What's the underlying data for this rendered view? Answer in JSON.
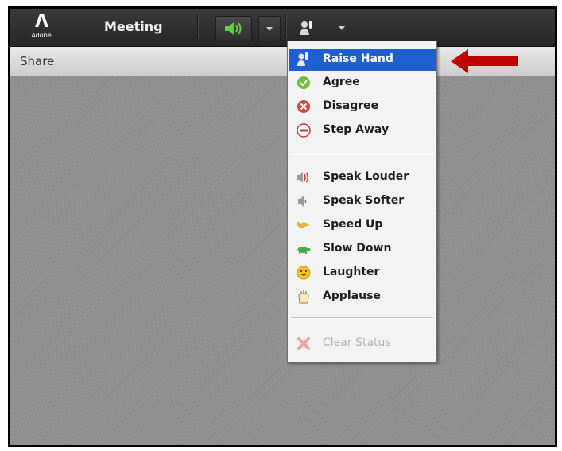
{
  "app": {
    "logo_text": "Adobe",
    "menu_title": "Meeting"
  },
  "toolbar": {
    "audio_icon": "speaker-icon",
    "status_icon": "raise-hand-icon"
  },
  "pod": {
    "title": "Share"
  },
  "status_menu": {
    "items_group1": [
      {
        "label": "Raise Hand",
        "icon": "raise-hand-icon",
        "selected": true
      },
      {
        "label": "Agree",
        "icon": "agree-icon"
      },
      {
        "label": "Disagree",
        "icon": "disagree-icon"
      },
      {
        "label": "Step Away",
        "icon": "step-away-icon"
      }
    ],
    "items_group2": [
      {
        "label": "Speak Louder",
        "icon": "speak-louder-icon"
      },
      {
        "label": "Speak Softer",
        "icon": "speak-softer-icon"
      },
      {
        "label": "Speed Up",
        "icon": "speed-up-icon"
      },
      {
        "label": "Slow Down",
        "icon": "slow-down-icon"
      },
      {
        "label": "Laughter",
        "icon": "laughter-icon"
      },
      {
        "label": "Applause",
        "icon": "applause-icon"
      }
    ],
    "items_group3": [
      {
        "label": "Clear Status",
        "icon": "clear-status-icon",
        "disabled": true
      }
    ]
  },
  "colors": {
    "selection": "#1f5fcf",
    "arrow": "#c00000",
    "audio_green": "#5fd23a"
  }
}
